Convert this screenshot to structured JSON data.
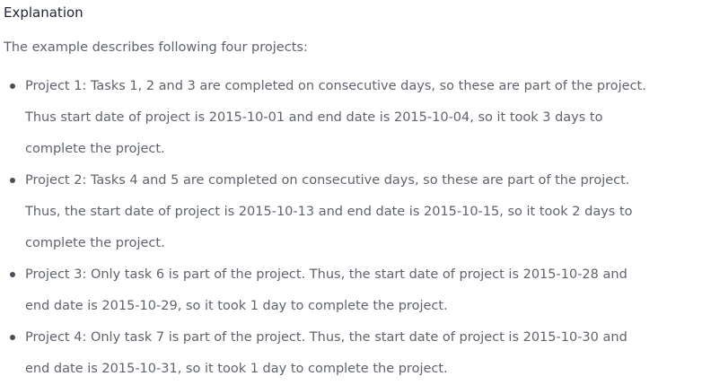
{
  "heading": "Explanation",
  "intro": "The example describes following four projects:",
  "projects": [
    {
      "lines": [
        "Project 1: Tasks 1, 2 and 3 are completed on consecutive days, so these are part of the project.",
        "Thus start date of project is 2015-10-01 and end date is 2015-10-04, so it took 3 days to",
        "complete the project."
      ]
    },
    {
      "lines": [
        "Project 2: Tasks 4 and 5 are completed on consecutive days, so these are part of the project.",
        "Thus, the start date of project is 2015-10-13 and end date is 2015-10-15, so it took 2 days to",
        "complete the project."
      ]
    },
    {
      "lines": [
        "Project 3: Only task 6 is part of the project. Thus, the start date of project is 2015-10-28 and",
        "end date is 2015-10-29, so it took 1 day to complete the project."
      ]
    },
    {
      "lines": [
        "Project 4: Only task 7 is part of the project. Thus, the start date of project is 2015-10-30 and",
        "end date is 2015-10-31, so it took 1 day to complete the project."
      ]
    }
  ]
}
